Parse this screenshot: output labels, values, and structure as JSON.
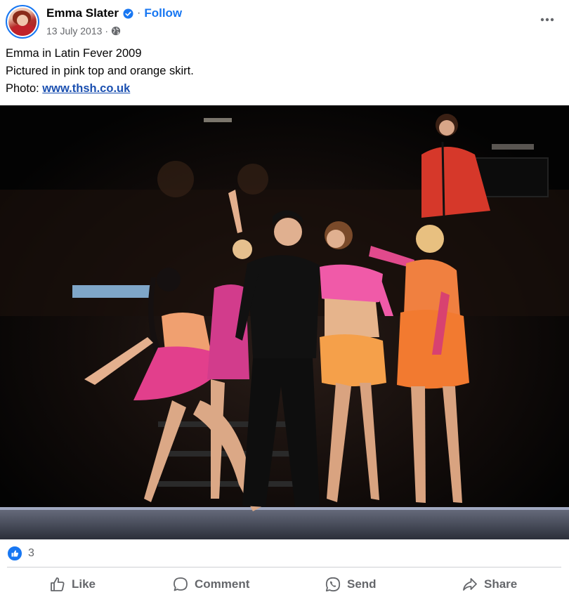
{
  "post": {
    "author": "Emma Slater",
    "follow_label": "Follow",
    "separator": "·",
    "date": "13 July 2013",
    "caption": {
      "line1": "Emma in Latin Fever 2009",
      "line2": "Pictured in pink top and orange skirt.",
      "line3_prefix": "Photo: ",
      "link_text": "www.thsh.co.uk"
    }
  },
  "icons": {
    "verified": "verified-badge-icon",
    "privacy": "globe-icon",
    "more": "more-options-icon"
  },
  "reactions": {
    "count": "3"
  },
  "actions": {
    "like": "Like",
    "comment": "Comment",
    "send": "Send",
    "share": "Share"
  },
  "colors": {
    "brand_blue": "#1877f2",
    "link_blue": "#1a4fb0",
    "secondary_text": "#65676b"
  }
}
